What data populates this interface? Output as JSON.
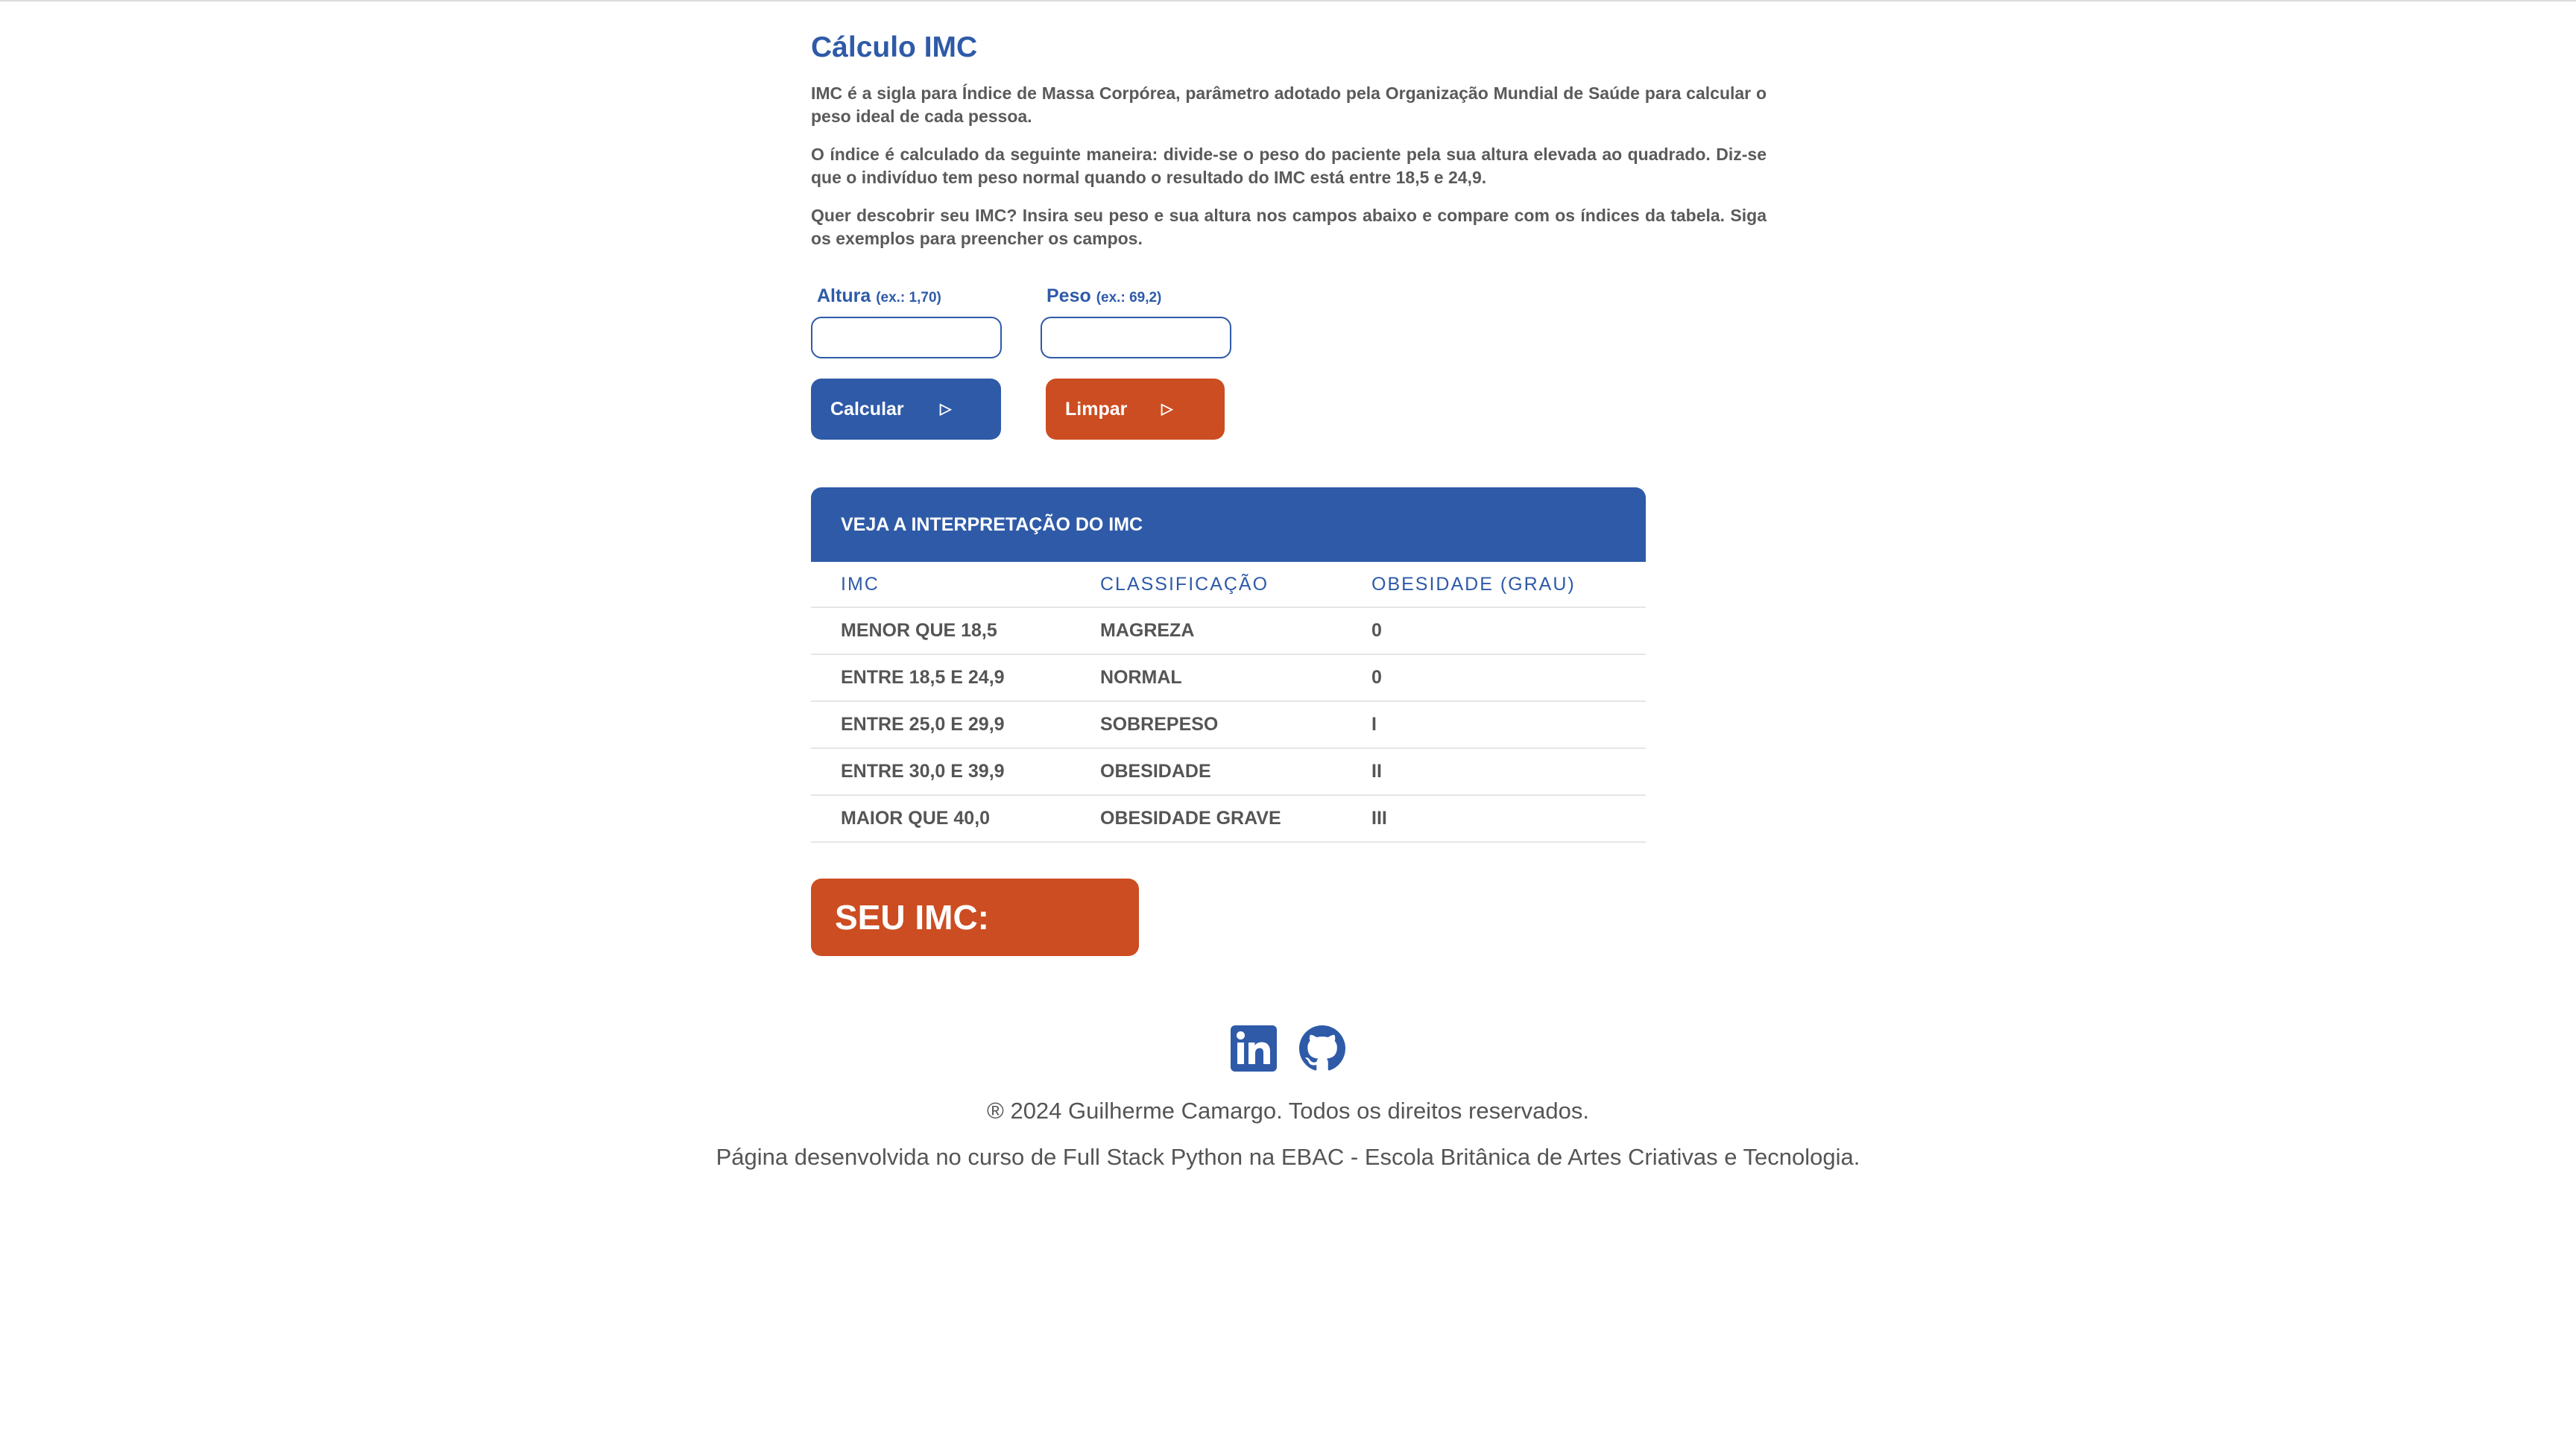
{
  "page": {
    "title": "Cálculo IMC",
    "intro": [
      "IMC é a sigla para Índice de Massa Corpórea, parâmetro adotado pela Organização Mundial de Saúde para calcular o peso ideal de cada pessoa.",
      "O índice é calculado da seguinte maneira: divide-se o peso do paciente pela sua altura elevada ao quadrado. Diz-se que o indivíduo tem peso normal quando o resultado do IMC está entre 18,5 e 24,9.",
      "Quer descobrir seu IMC? Insira seu peso e sua altura nos campos abaixo e compare com os índices da tabela. Siga os exemplos para preencher os campos."
    ]
  },
  "form": {
    "altura_label": "Altura",
    "altura_hint": "(ex.: 1,70)",
    "altura_value": "",
    "peso_label": "Peso",
    "peso_hint": "(ex.: 69,2)",
    "peso_value": "",
    "calc_button": "Calcular",
    "clear_button": "Limpar",
    "button_icon": "play-outline-icon"
  },
  "table": {
    "heading": "VEJA A INTERPRETAÇÃO DO IMC",
    "columns": [
      "IMC",
      "CLASSIFICAÇÃO",
      "OBESIDADE (GRAU)"
    ],
    "rows": [
      [
        "MENOR QUE 18,5",
        "MAGREZA",
        "0"
      ],
      [
        "ENTRE 18,5 E 24,9",
        "NORMAL",
        "0"
      ],
      [
        "ENTRE 25,0 E 29,9",
        "SOBREPESO",
        "I"
      ],
      [
        "ENTRE 30,0 E 39,9",
        "OBESIDADE",
        "II"
      ],
      [
        "MAIOR QUE 40,0",
        "OBESIDADE GRAVE",
        "III"
      ]
    ]
  },
  "result": {
    "label": "SEU IMC:"
  },
  "footer": {
    "social": [
      "linkedin-icon",
      "github-icon"
    ],
    "copyright": "® 2024 Guilherme Camargo. Todos os direitos reservados.",
    "course": "Página desenvolvida no curso de Full Stack Python na EBAC - Escola Britânica de Artes Criativas e Tecnologia."
  },
  "colors": {
    "primary_blue": "#2e5aa8",
    "accent_orange": "#cc4d21",
    "text_gray": "#555555"
  }
}
